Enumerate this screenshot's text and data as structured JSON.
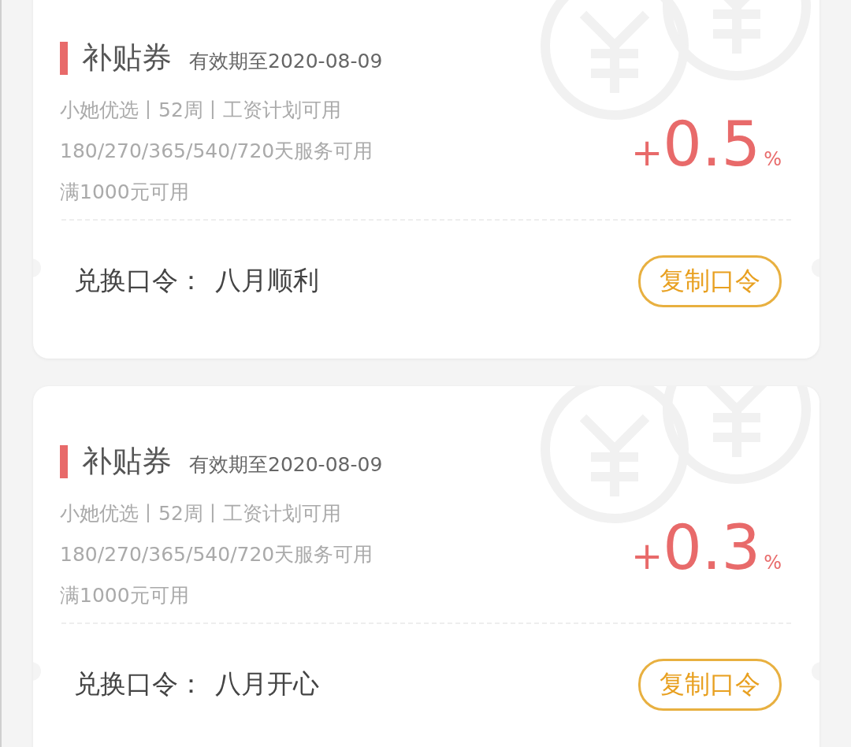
{
  "coupons": [
    {
      "title": "补贴券",
      "validity": "有效期至2020-08-09",
      "lines": [
        "小她优选丨52周丨工资计划可用",
        "180/270/365/540/720天服务可用",
        "满1000元可用"
      ],
      "value_sign": "+",
      "value": "0.5",
      "value_unit": "%",
      "code_label": "兑换口令：",
      "code": "八月顺利",
      "button": "复制口令"
    },
    {
      "title": "补贴券",
      "validity": "有效期至2020-08-09",
      "lines": [
        "小她优选丨52周丨工资计划可用",
        "180/270/365/540/720天服务可用",
        "满1000元可用"
      ],
      "value_sign": "+",
      "value": "0.3",
      "value_unit": "%",
      "code_label": "兑换口令：",
      "code": "八月开心",
      "button": "复制口令"
    }
  ]
}
